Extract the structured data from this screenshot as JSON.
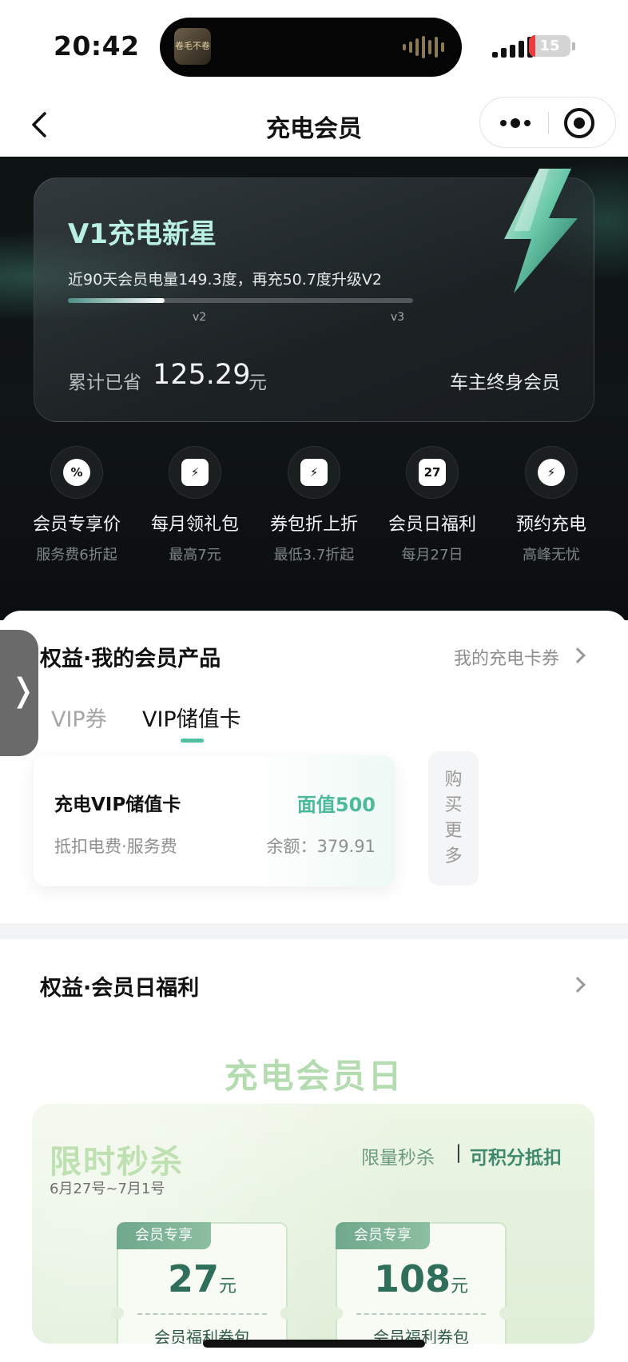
{
  "status_bar": {
    "time": "20:42",
    "battery": "15",
    "battery_fraction": 0.15,
    "island_thumb_text": "卷毛不卷"
  },
  "nav": {
    "title": "充电会员"
  },
  "level_card": {
    "title": "V1充电新星",
    "description": "近90天会员电量149.3度，再充50.7度升级V2",
    "progress_fraction": 0.28,
    "tick_v2": "v2",
    "tick_v3": "v3",
    "saved_label": "累计已省",
    "saved_value": "125.29",
    "saved_unit": "元",
    "owner_link": "车主终身会员"
  },
  "benefits": [
    {
      "title": "会员专享价",
      "subtitle": "服务费6折起",
      "icon": "diamond-percent-icon",
      "glyph": "%"
    },
    {
      "title": "每月领礼包",
      "subtitle": "最高7元",
      "icon": "gift-icon",
      "glyph": "⚡"
    },
    {
      "title": "券包折上折",
      "subtitle": "最低3.7折起",
      "icon": "ticket-icon",
      "glyph": "⚡"
    },
    {
      "title": "会员日福利",
      "subtitle": "每月27日",
      "icon": "calendar-icon",
      "glyph": "27"
    },
    {
      "title": "预约充电",
      "subtitle": "高峰无忧",
      "icon": "alarm-clock-icon",
      "glyph": "⚡"
    }
  ],
  "products_section": {
    "title": "权益·我的会员产品",
    "link": "我的充电卡券",
    "tabs": [
      "VIP券",
      "VIP储值卡"
    ],
    "active_tab": "VIP储值卡",
    "card": {
      "name": "充电VIP储值卡",
      "face_value": "面值500",
      "usage": "抵扣电费·服务费",
      "balance": "余额：379.91"
    },
    "buy_more": [
      "购",
      "买",
      "更",
      "多"
    ]
  },
  "member_day_section": {
    "title": "权益·会员日福利",
    "banner_title": "充电会员日",
    "promo": {
      "title": "限时秒杀",
      "date": "6月27号~7月1号",
      "tag1": "限量秒杀",
      "separator": "|",
      "tag2": "可积分抵扣",
      "coupons": [
        {
          "tag": "会员专享",
          "amount": "27",
          "unit": "元",
          "name": "会员福利券包"
        },
        {
          "tag": "会员专享",
          "amount": "108",
          "unit": "元",
          "name": "会员福利券包"
        }
      ]
    }
  },
  "side_tab": {
    "glyph": "❭"
  },
  "colors": {
    "accent": "#4fc1a0",
    "hero_bg": "#0e1314",
    "level_title": "#b9efe4",
    "coupon_text": "#2f6e5a"
  }
}
